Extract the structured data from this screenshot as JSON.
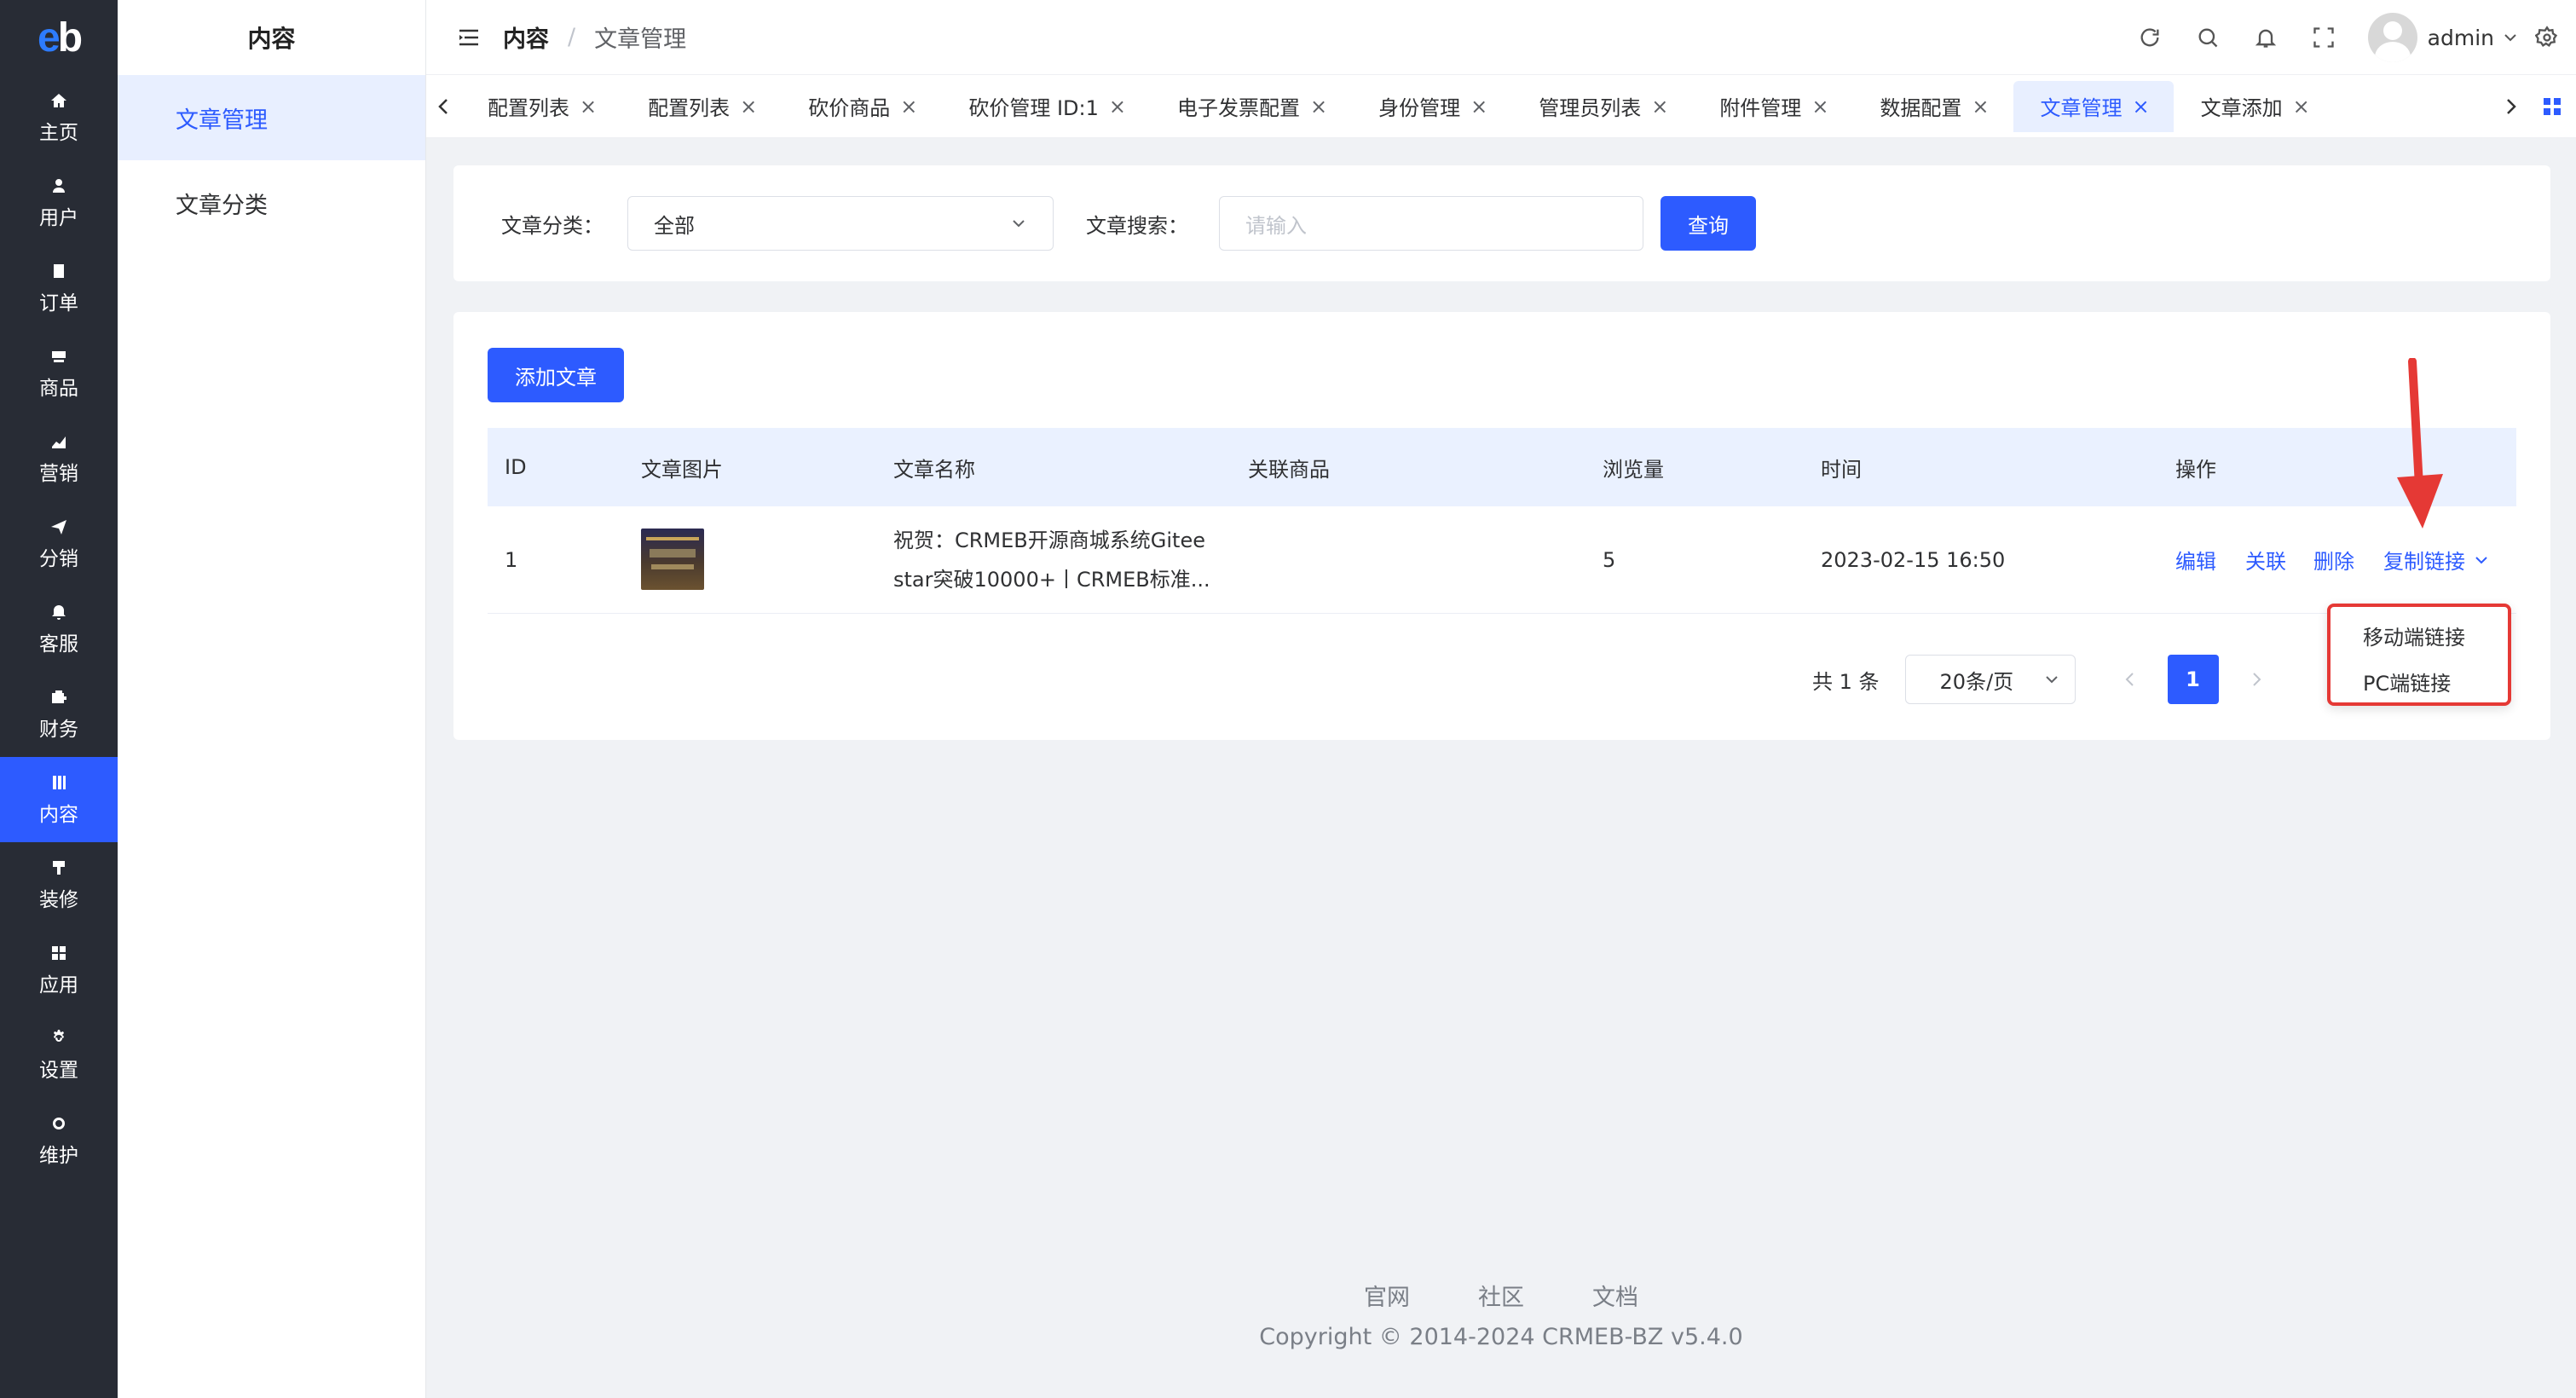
{
  "brand": {
    "logo_text": "eb",
    "accent": "#2d5bff"
  },
  "rail": [
    {
      "label": "主页",
      "icon": "home-icon"
    },
    {
      "label": "用户",
      "icon": "user-icon"
    },
    {
      "label": "订单",
      "icon": "order-icon"
    },
    {
      "label": "商品",
      "icon": "product-icon"
    },
    {
      "label": "营销",
      "icon": "marketing-icon"
    },
    {
      "label": "分销",
      "icon": "distribution-icon"
    },
    {
      "label": "客服",
      "icon": "service-icon"
    },
    {
      "label": "财务",
      "icon": "finance-icon"
    },
    {
      "label": "内容",
      "icon": "content-icon",
      "active": true
    },
    {
      "label": "装修",
      "icon": "decoration-icon"
    },
    {
      "label": "应用",
      "icon": "apps-icon"
    },
    {
      "label": "设置",
      "icon": "settings-icon"
    },
    {
      "label": "维护",
      "icon": "maintenance-icon"
    }
  ],
  "subside": {
    "title": "内容",
    "items": [
      {
        "label": "文章管理",
        "active": true
      },
      {
        "label": "文章分类"
      }
    ]
  },
  "header": {
    "breadcrumb": [
      "内容",
      "文章管理"
    ],
    "breadcrumb_sep": "/",
    "username": "admin"
  },
  "tabs": [
    {
      "label": "配置列表"
    },
    {
      "label": "配置列表"
    },
    {
      "label": "砍价商品"
    },
    {
      "label": "砍价管理 ID:1"
    },
    {
      "label": "电子发票配置"
    },
    {
      "label": "身份管理"
    },
    {
      "label": "管理员列表"
    },
    {
      "label": "附件管理"
    },
    {
      "label": "数据配置"
    },
    {
      "label": "文章管理",
      "active": true
    },
    {
      "label": "文章添加"
    }
  ],
  "filter": {
    "category_label": "文章分类：",
    "category_value": "全部",
    "search_label": "文章搜索：",
    "search_placeholder": "请输入",
    "query_button": "查询"
  },
  "list": {
    "add_button": "添加文章",
    "columns": [
      "ID",
      "文章图片",
      "文章名称",
      "关联商品",
      "浏览量",
      "时间",
      "操作"
    ],
    "rows": [
      {
        "id": "1",
        "name_line1": "祝贺：CRMEB开源商城系统Gitee",
        "name_line2": "star突破10000+丨CRMEB标准...",
        "product": "",
        "views": "5",
        "time": "2023-02-15 16:50",
        "actions": [
          "编辑",
          "关联",
          "删除",
          "复制链接"
        ]
      }
    ],
    "dropdown": [
      "移动端链接",
      "PC端链接"
    ]
  },
  "pager": {
    "total": "共 1 条",
    "page_size": "20条/页",
    "current": "1"
  },
  "footer": {
    "links": [
      "官网",
      "社区",
      "文档"
    ],
    "copyright": "Copyright © 2014-2024 CRMEB-BZ v5.4.0"
  }
}
